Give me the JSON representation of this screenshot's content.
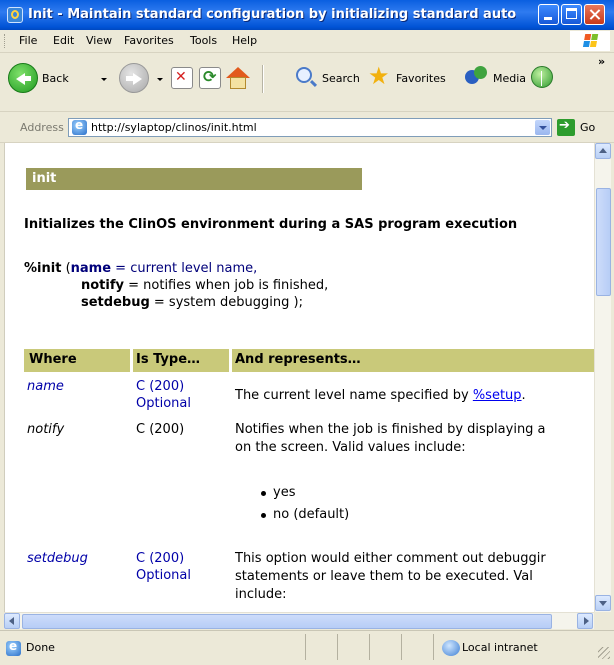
{
  "window": {
    "title": "Init - Maintain standard configuration by initializing standard autoe..."
  },
  "menu": {
    "items": [
      "File",
      "Edit",
      "View",
      "Favorites",
      "Tools",
      "Help"
    ]
  },
  "toolbar": {
    "back_label": "Back",
    "search_label": "Search",
    "favorites_label": "Favorites",
    "media_label": "Media",
    "more": "»"
  },
  "address": {
    "label": "Address",
    "url": "http://sylaptop/clinos/init.html",
    "go_label": "Go"
  },
  "page": {
    "header": "init",
    "description": "Initializes the ClinOS environment during a SAS program execution",
    "syntax": {
      "macro": "%init",
      "open_paren": "(",
      "line1_param": "name",
      "line1_rest": " = current level name,",
      "line2_param": "notify",
      "line2_rest": " = notifies when job is finished,",
      "line3_param": "setdebug",
      "line3_rest": " = system debugging );"
    },
    "table": {
      "headers": [
        "Where",
        "Is Type…",
        "And represents…"
      ],
      "rows": [
        {
          "where": "name",
          "type1": "C (200)",
          "type2": "Optional",
          "desc_line1": "The current level name specified by ",
          "desc_link": "%setup",
          "desc_after_link": "."
        },
        {
          "where": "notify",
          "type1": "C (200)",
          "type2": "",
          "desc_line1": "Notifies when the job is finished by displaying a",
          "desc_line2": "on the screen.  Valid values include:",
          "bullets": [
            "yes",
            "no (default)"
          ]
        },
        {
          "where": "setdebug",
          "type1": "C (200)",
          "type2": "Optional",
          "desc_line1": "This option would either comment out debuggir",
          "desc_line2": "statements or leave them to be executed.  Val",
          "desc_line3": "include:"
        }
      ]
    }
  },
  "status": {
    "text": "Done",
    "zone": "Local intranet"
  },
  "colors": {
    "titlebar": "#0a5fe0",
    "header_bar": "#9a9a5b",
    "table_header": "#c9c97a",
    "link": "#0000ee",
    "param_blue": "#0000a8"
  }
}
